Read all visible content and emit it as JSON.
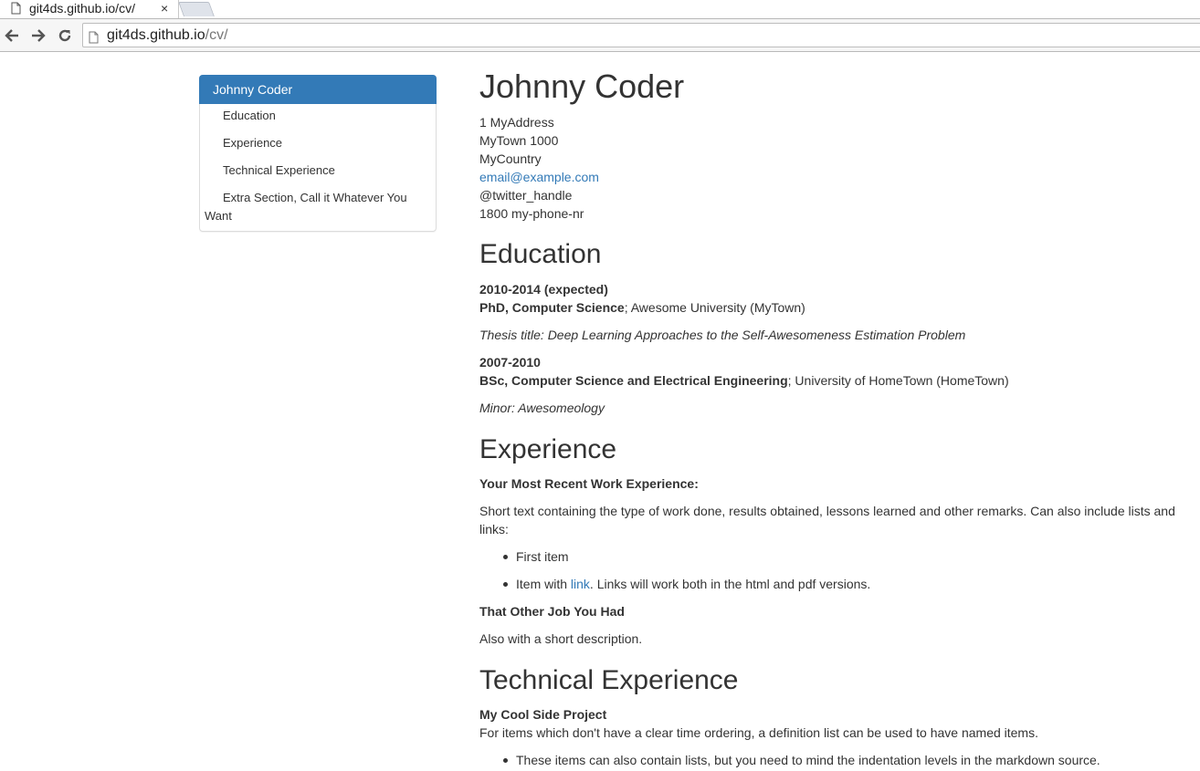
{
  "browser": {
    "tab_title": "git4ds.github.io/cv/",
    "close_glyph": "×",
    "url_domain": "git4ds.github.io",
    "url_path": "/cv/",
    "icons": [
      "page-icon",
      "close-icon",
      "back-icon",
      "forward-icon",
      "reload-icon"
    ]
  },
  "sidebar": {
    "items": [
      {
        "label": "Johnny Coder",
        "active": true
      },
      {
        "label": "Education"
      },
      {
        "label": "Experience"
      },
      {
        "label": "Technical Experience"
      },
      {
        "label": "Extra Section, Call it Whatever You Want"
      }
    ],
    "active_color": "#337ab7"
  },
  "header": {
    "name": "Johnny Coder",
    "address1": "1 MyAddress",
    "address2": "MyTown 1000",
    "country": "MyCountry",
    "email": "email@example.com",
    "twitter": "@twitter_handle",
    "phone": "1800 my-phone-nr"
  },
  "education": {
    "title": "Education",
    "entries": [
      {
        "years": "2010-2014 (expected)",
        "degree": "PhD, Computer Science",
        "school": "; Awesome University (MyTown)",
        "note": "Thesis title: Deep Learning Approaches to the Self-Awesomeness Estimation Problem"
      },
      {
        "years": "2007-2010",
        "degree": "BSc, Computer Science and Electrical Engineering",
        "school": "; University of HomeTown (HomeTown)",
        "note": "Minor: Awesomeology"
      }
    ]
  },
  "experience": {
    "title": "Experience",
    "job1_title": "Your Most Recent Work Experience:",
    "job1_desc_line1": "Short text containing the type of work done, results obtained, lessons learned and other remarks. Can also include lists and",
    "job1_desc_line2": "links:",
    "item1": "First item",
    "item2_pre": "Item with ",
    "item2_link": "link",
    "item2_post": ". Links will work both in the html and pdf versions.",
    "job2_title": "That Other Job You Had",
    "job2_desc": "Also with a short description."
  },
  "technical": {
    "title": "Technical Experience",
    "project_title": "My Cool Side Project",
    "project_desc": "For items which don't have a clear time ordering, a definition list can be used to have named items.",
    "bullet1": "These items can also contain lists, but you need to mind the indentation levels in the markdown source."
  },
  "colors": {
    "link": "#337ab7",
    "text": "#333333"
  }
}
